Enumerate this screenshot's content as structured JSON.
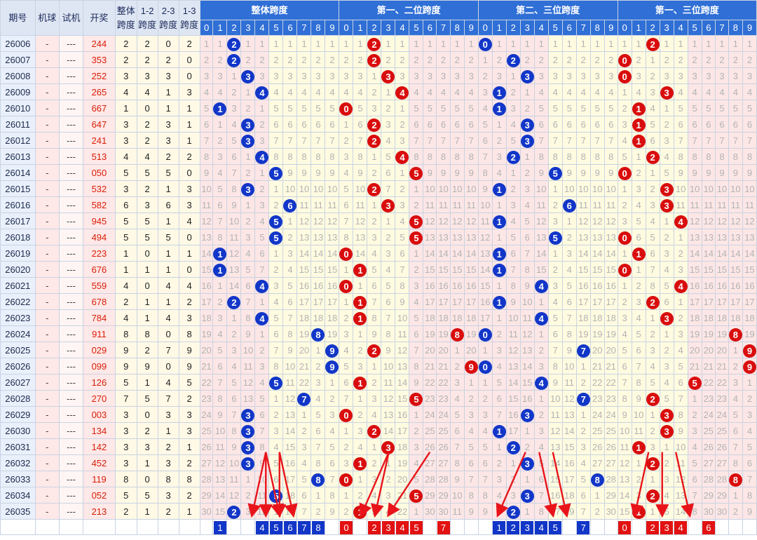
{
  "table": {
    "headers": {
      "issue": "期号",
      "ball": "机球",
      "trial": "试机",
      "draw": "开奖",
      "span_total": "整体跨度",
      "span12": "1-2跨度",
      "span23": "2-3跨度",
      "span13": "1-3跨度"
    },
    "groups": [
      "整体跨度",
      "第一、二位跨度",
      "第二、三位跨度",
      "第一、三位跨度"
    ],
    "digits": [
      "0",
      "1",
      "2",
      "3",
      "4",
      "5",
      "6",
      "7",
      "8",
      "9"
    ],
    "rows": [
      {
        "issue": "26006",
        "ball": "-",
        "trial": "---",
        "draw": "244",
        "spans": [
          2,
          2,
          0,
          2
        ]
      },
      {
        "issue": "26007",
        "ball": "-",
        "trial": "---",
        "draw": "353",
        "spans": [
          2,
          2,
          2,
          0
        ]
      },
      {
        "issue": "26008",
        "ball": "-",
        "trial": "---",
        "draw": "252",
        "spans": [
          3,
          3,
          3,
          0
        ]
      },
      {
        "issue": "26009",
        "ball": "-",
        "trial": "---",
        "draw": "265",
        "spans": [
          4,
          4,
          1,
          3
        ]
      },
      {
        "issue": "26010",
        "ball": "-",
        "trial": "---",
        "draw": "667",
        "spans": [
          1,
          0,
          1,
          1
        ]
      },
      {
        "issue": "26011",
        "ball": "-",
        "trial": "---",
        "draw": "647",
        "spans": [
          3,
          2,
          3,
          1
        ]
      },
      {
        "issue": "26012",
        "ball": "-",
        "trial": "---",
        "draw": "241",
        "spans": [
          3,
          2,
          3,
          1
        ]
      },
      {
        "issue": "26013",
        "ball": "-",
        "trial": "---",
        "draw": "513",
        "spans": [
          4,
          4,
          2,
          2
        ]
      },
      {
        "issue": "26014",
        "ball": "-",
        "trial": "---",
        "draw": "050",
        "spans": [
          5,
          5,
          5,
          0
        ]
      },
      {
        "issue": "26015",
        "ball": "-",
        "trial": "---",
        "draw": "532",
        "spans": [
          3,
          2,
          1,
          3
        ]
      },
      {
        "issue": "26016",
        "ball": "-",
        "trial": "---",
        "draw": "582",
        "spans": [
          6,
          3,
          6,
          3
        ]
      },
      {
        "issue": "26017",
        "ball": "-",
        "trial": "---",
        "draw": "945",
        "spans": [
          5,
          5,
          1,
          4
        ]
      },
      {
        "issue": "26018",
        "ball": "-",
        "trial": "---",
        "draw": "494",
        "spans": [
          5,
          5,
          5,
          0
        ]
      },
      {
        "issue": "26019",
        "ball": "-",
        "trial": "---",
        "draw": "223",
        "spans": [
          1,
          0,
          1,
          1
        ]
      },
      {
        "issue": "26020",
        "ball": "-",
        "trial": "---",
        "draw": "676",
        "spans": [
          1,
          1,
          1,
          0
        ]
      },
      {
        "issue": "26021",
        "ball": "-",
        "trial": "---",
        "draw": "559",
        "spans": [
          4,
          0,
          4,
          4
        ]
      },
      {
        "issue": "26022",
        "ball": "-",
        "trial": "---",
        "draw": "678",
        "spans": [
          2,
          1,
          1,
          2
        ]
      },
      {
        "issue": "26023",
        "ball": "-",
        "trial": "---",
        "draw": "784",
        "spans": [
          4,
          1,
          4,
          3
        ]
      },
      {
        "issue": "26024",
        "ball": "-",
        "trial": "---",
        "draw": "911",
        "spans": [
          8,
          8,
          0,
          8
        ]
      },
      {
        "issue": "26025",
        "ball": "-",
        "trial": "---",
        "draw": "029",
        "spans": [
          9,
          2,
          7,
          9
        ]
      },
      {
        "issue": "26026",
        "ball": "-",
        "trial": "---",
        "draw": "099",
        "spans": [
          9,
          9,
          0,
          9
        ]
      },
      {
        "issue": "26027",
        "ball": "-",
        "trial": "---",
        "draw": "126",
        "spans": [
          5,
          1,
          4,
          5
        ]
      },
      {
        "issue": "26028",
        "ball": "-",
        "trial": "---",
        "draw": "270",
        "spans": [
          7,
          5,
          7,
          2
        ]
      },
      {
        "issue": "26029",
        "ball": "-",
        "trial": "---",
        "draw": "003",
        "spans": [
          3,
          0,
          3,
          3
        ]
      },
      {
        "issue": "26030",
        "ball": "-",
        "trial": "---",
        "draw": "134",
        "spans": [
          3,
          2,
          1,
          3
        ]
      },
      {
        "issue": "26031",
        "ball": "-",
        "trial": "---",
        "draw": "142",
        "spans": [
          3,
          3,
          2,
          1
        ]
      },
      {
        "issue": "26032",
        "ball": "-",
        "trial": "---",
        "draw": "452",
        "spans": [
          3,
          1,
          3,
          2
        ]
      },
      {
        "issue": "26033",
        "ball": "-",
        "trial": "---",
        "draw": "119",
        "spans": [
          8,
          0,
          8,
          8
        ]
      },
      {
        "issue": "26034",
        "ball": "-",
        "trial": "---",
        "draw": "052",
        "spans": [
          5,
          5,
          3,
          2
        ]
      },
      {
        "issue": "26035",
        "ball": "-",
        "trial": "---",
        "draw": "213",
        "spans": [
          2,
          1,
          2,
          1
        ]
      }
    ],
    "predictions": [
      [
        1,
        4,
        5,
        6,
        7,
        8
      ],
      [
        0,
        2,
        3,
        4,
        5,
        7
      ],
      [
        1,
        2,
        3,
        4,
        5,
        7
      ],
      [
        0,
        2,
        3,
        4,
        6
      ]
    ]
  },
  "colors": {
    "blue_ball": "#1236c8",
    "red_ball": "#d90d0d",
    "header_blue": "#2f6fd6",
    "draw_red": "#d81e06",
    "arrow_red": "#e8141a"
  }
}
